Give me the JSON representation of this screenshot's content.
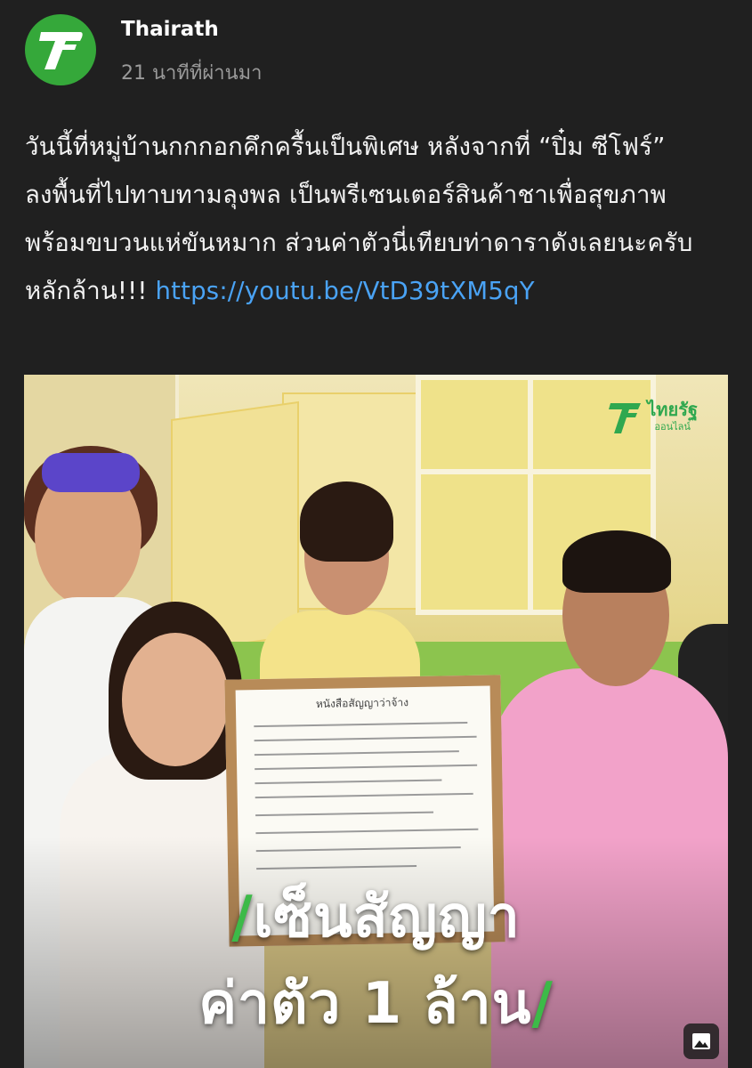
{
  "post": {
    "page_name": "Thairath",
    "time": "21 นาทีที่ผ่านมา",
    "text": "วันนี้ที่หมู่บ้านกกกอกคึกครื้นเป็นพิเศษ หลังจากที่ “ปิ๋ม ซีโฟร์” ลงพื้นที่ไปทาบทามลุงพล เป็นพรีเซนเตอร์สินค้าชาเพื่อสุขภาพ พร้อมขบวนแห่ขันหมาก ส่วนค่าตัวนี่เทียบท่าดาราดังเลยนะครับ หลักล้าน!!! ",
    "link": "https://youtu.be/VtD39tXM5qY"
  },
  "media": {
    "logo_text": "ไทยรัฐ",
    "logo_sub": "ออนไลน์",
    "caption_line1": "เซ็นสัญญา",
    "caption_line2": "ค่าตัว 1 ล้าน",
    "certificate_title": "หนังสือสัญญาว่าจ้าง",
    "slash": "/"
  },
  "icons": {
    "avatar": "thairath-t-logo",
    "media_type": "image-icon"
  },
  "colors": {
    "background": "#202020",
    "link": "#4aa3f5",
    "brand_green": "#35a83a"
  }
}
